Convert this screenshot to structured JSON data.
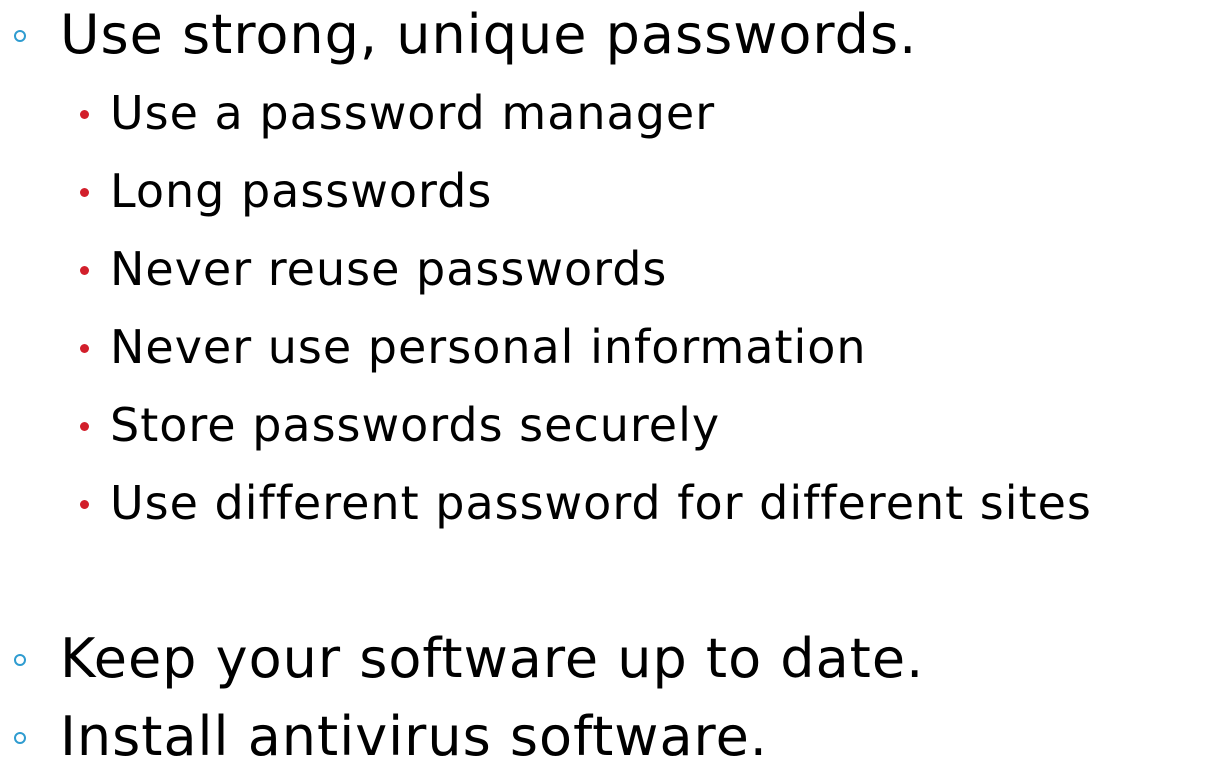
{
  "slide": {
    "colors": {
      "level1_marker": "#2f9cd0",
      "level2_marker": "#d21f2b"
    },
    "items": [
      {
        "text": "Use strong, unique passwords.",
        "subitems": [
          "Use a password manager",
          "Long passwords",
          "Never reuse passwords",
          "Never use personal information",
          "Store passwords securely",
          "Use different password for different sites"
        ]
      },
      {
        "text": "Keep your software up to date."
      },
      {
        "text": "Install antivirus software."
      }
    ]
  }
}
